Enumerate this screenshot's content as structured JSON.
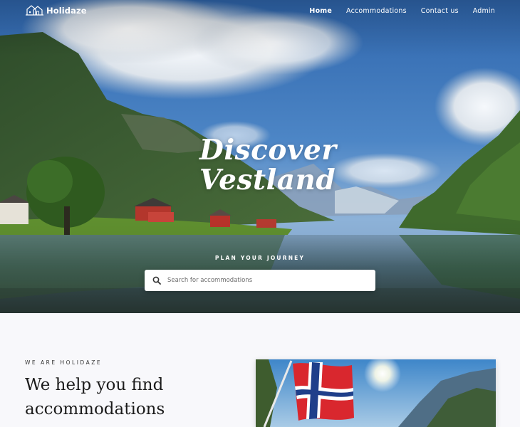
{
  "brand": {
    "name": "Holidaze"
  },
  "nav": {
    "items": [
      {
        "label": "Home",
        "active": true
      },
      {
        "label": "Accommodations",
        "active": false
      },
      {
        "label": "Contact us",
        "active": false
      },
      {
        "label": "Admin",
        "active": false
      }
    ]
  },
  "hero": {
    "title_line1": "Discover",
    "title_line2": "Vestland",
    "subtitle": "PLAN YOUR JOURNEY",
    "search": {
      "placeholder": "Search for accommodations",
      "value": ""
    }
  },
  "about": {
    "eyebrow": "WE ARE HOLIDAZE",
    "title_line1": "We help you find",
    "title_line2": "accommodations"
  },
  "colors": {
    "sky": "#3f78b8",
    "accent": "#ffffff",
    "text_dark": "#1b1b1b"
  },
  "icons": [
    "house-logo-icon",
    "search-icon"
  ]
}
